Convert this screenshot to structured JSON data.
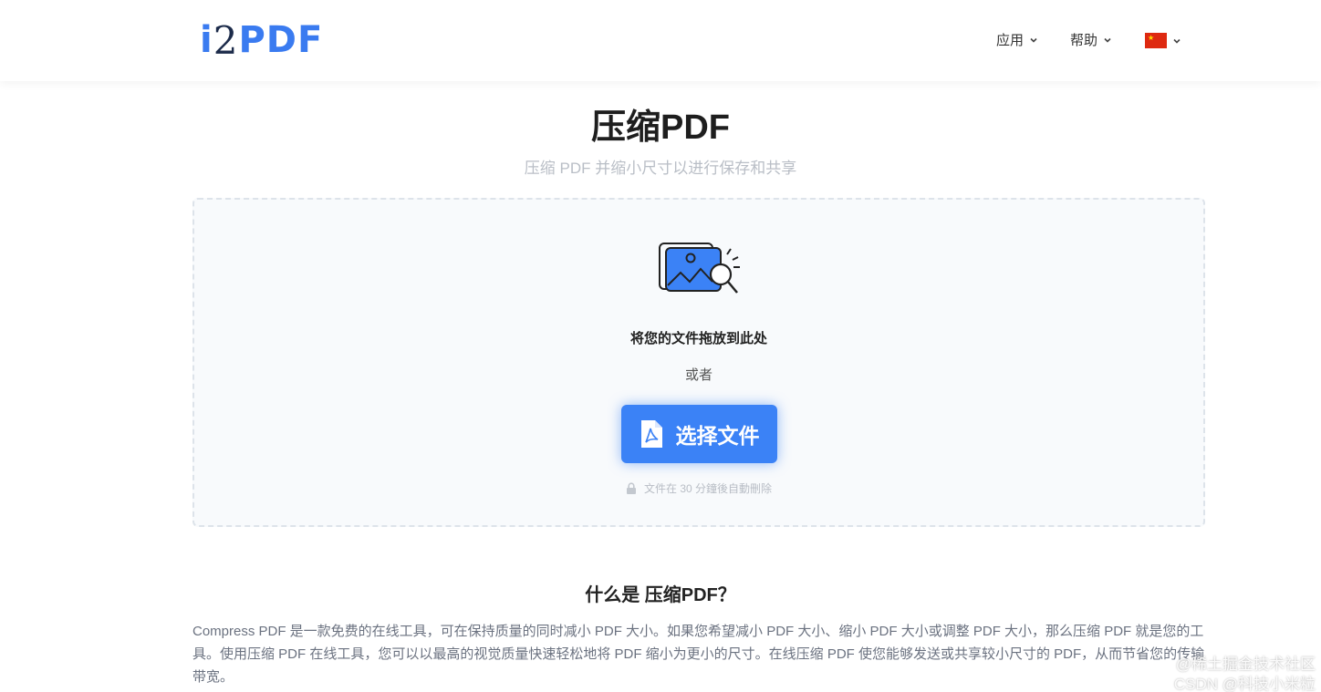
{
  "header": {
    "logo": {
      "i": "i",
      "two": "2",
      "pdf": "PDF"
    },
    "nav": [
      {
        "label": "应用"
      },
      {
        "label": "帮助"
      }
    ]
  },
  "main": {
    "title": "压缩PDF",
    "subtitle": "压缩 PDF 并缩小尺寸以进行保存和共享"
  },
  "dropzone": {
    "drop_text": "将您的文件拖放到此处",
    "or_text": "或者",
    "choose_button": "选择文件",
    "note": "文件在 30 分鐘後自動刪除"
  },
  "about": {
    "title": "什么是 压缩PDF？",
    "body": "Compress PDF 是一款免费的在线工具，可在保持质量的同时减小 PDF 大小。如果您希望减小 PDF 大小、缩小 PDF 大小或调整 PDF 大小，那么压缩 PDF 就是您的工具。使用压缩 PDF 在线工具，您可以以最高的视觉质量快速轻松地将 PDF 缩小为更小的尺寸。在线压缩 PDF 使您能够发送或共享较小尺寸的 PDF，从而节省您的传输带宽。"
  },
  "watermark": {
    "line1": "@稀土掘金技术社区",
    "line2": "CSDN @科技小米粒"
  },
  "colors": {
    "accent": "#3b82f6",
    "flag_red": "#de2910",
    "flag_star": "#ffde00"
  }
}
